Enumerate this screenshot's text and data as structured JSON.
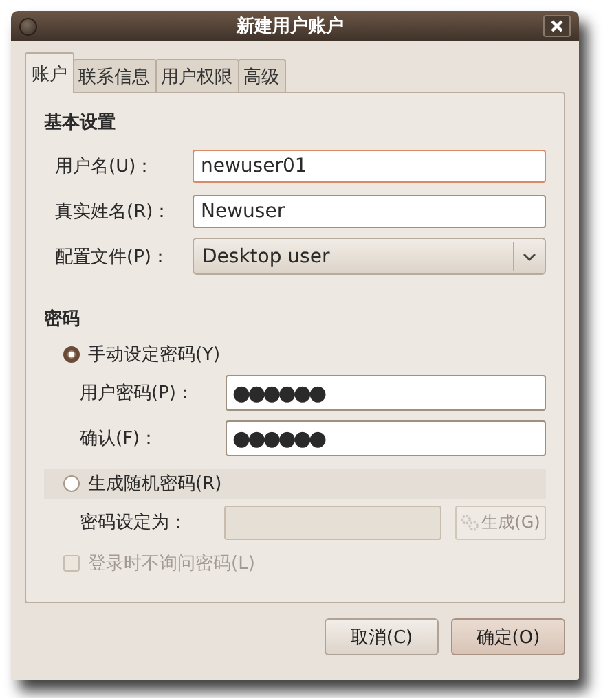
{
  "window": {
    "title": "新建用户账户"
  },
  "tabs": [
    {
      "label": "账户",
      "selected": true
    },
    {
      "label": "联系信息",
      "selected": false
    },
    {
      "label": "用户权限",
      "selected": false
    },
    {
      "label": "高级",
      "selected": false
    }
  ],
  "basic": {
    "heading": "基本设置",
    "rows": [
      {
        "kind": "text",
        "label": "用户名(U)：",
        "value": "newuser01",
        "focused": true
      },
      {
        "kind": "text",
        "label": "真实姓名(R)：",
        "value": "Newuser",
        "focused": false
      },
      {
        "kind": "combo",
        "label": "配置文件(P)：",
        "value": "Desktop user"
      }
    ]
  },
  "password": {
    "heading": "密码",
    "options": [
      {
        "label": "手动设定密码(Y)",
        "selected": true
      },
      {
        "label": "生成随机密码(R)",
        "selected": false
      }
    ],
    "fields": [
      {
        "label": "用户密码(P)：",
        "value": "●●●●●●"
      },
      {
        "label": "确认(F)：",
        "value": "●●●●●●"
      }
    ],
    "generated": {
      "label": "密码设定为：",
      "disabled": true
    },
    "generate_button": {
      "label": "生成(G)",
      "disabled": true
    },
    "no_ask": {
      "label": "登录时不询问密码(L)",
      "checked": false,
      "disabled": true
    }
  },
  "buttons": [
    {
      "label": "取消(C)",
      "default": false
    },
    {
      "label": "确定(O)",
      "default": true
    }
  ]
}
